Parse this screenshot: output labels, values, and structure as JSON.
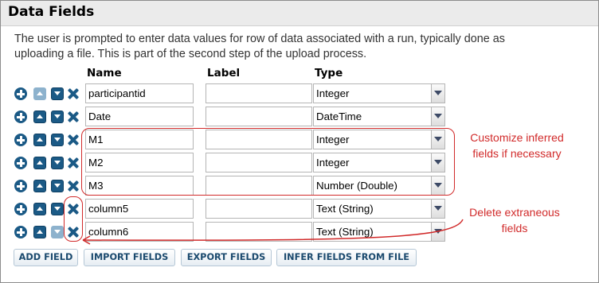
{
  "panel": {
    "title": "Data Fields",
    "description_line1": "The user is prompted to enter data values for row of data associated with a run, typically done as",
    "description_line2": "uploading a file. This is part of the second step of the upload process."
  },
  "columns": {
    "name": "Name",
    "label": "Label",
    "type": "Type"
  },
  "fields": [
    {
      "name": "participantid",
      "label": "",
      "type": "Integer",
      "up_enabled": false,
      "down_enabled": true
    },
    {
      "name": "Date",
      "label": "",
      "type": "DateTime",
      "up_enabled": true,
      "down_enabled": true
    },
    {
      "name": "M1",
      "label": "",
      "type": "Integer",
      "up_enabled": true,
      "down_enabled": true
    },
    {
      "name": "M2",
      "label": "",
      "type": "Integer",
      "up_enabled": true,
      "down_enabled": true
    },
    {
      "name": "M3",
      "label": "",
      "type": "Number (Double)",
      "up_enabled": true,
      "down_enabled": true
    },
    {
      "name": "column5",
      "label": "",
      "type": "Text (String)",
      "up_enabled": true,
      "down_enabled": true
    },
    {
      "name": "column6",
      "label": "",
      "type": "Text (String)",
      "up_enabled": true,
      "down_enabled": false
    }
  ],
  "buttons": {
    "add_field": "ADD FIELD",
    "import_fields": "IMPORT FIELDS",
    "export_fields": "EXPORT FIELDS",
    "infer_fields": "INFER FIELDS FROM FILE"
  },
  "annotations": {
    "customize_line1": "Customize inferred",
    "customize_line2": "fields if necessary",
    "delete_line1": "Delete extraneous",
    "delete_line2": "fields"
  },
  "colors": {
    "icon_blue": "#1b5a86",
    "icon_disabled": "#8db2cd",
    "annotation_red": "#d12a2a",
    "header_bg": "#ebebeb"
  },
  "icons": [
    "add-icon",
    "move-up-icon",
    "move-down-icon",
    "delete-icon",
    "dropdown-arrow-icon"
  ]
}
